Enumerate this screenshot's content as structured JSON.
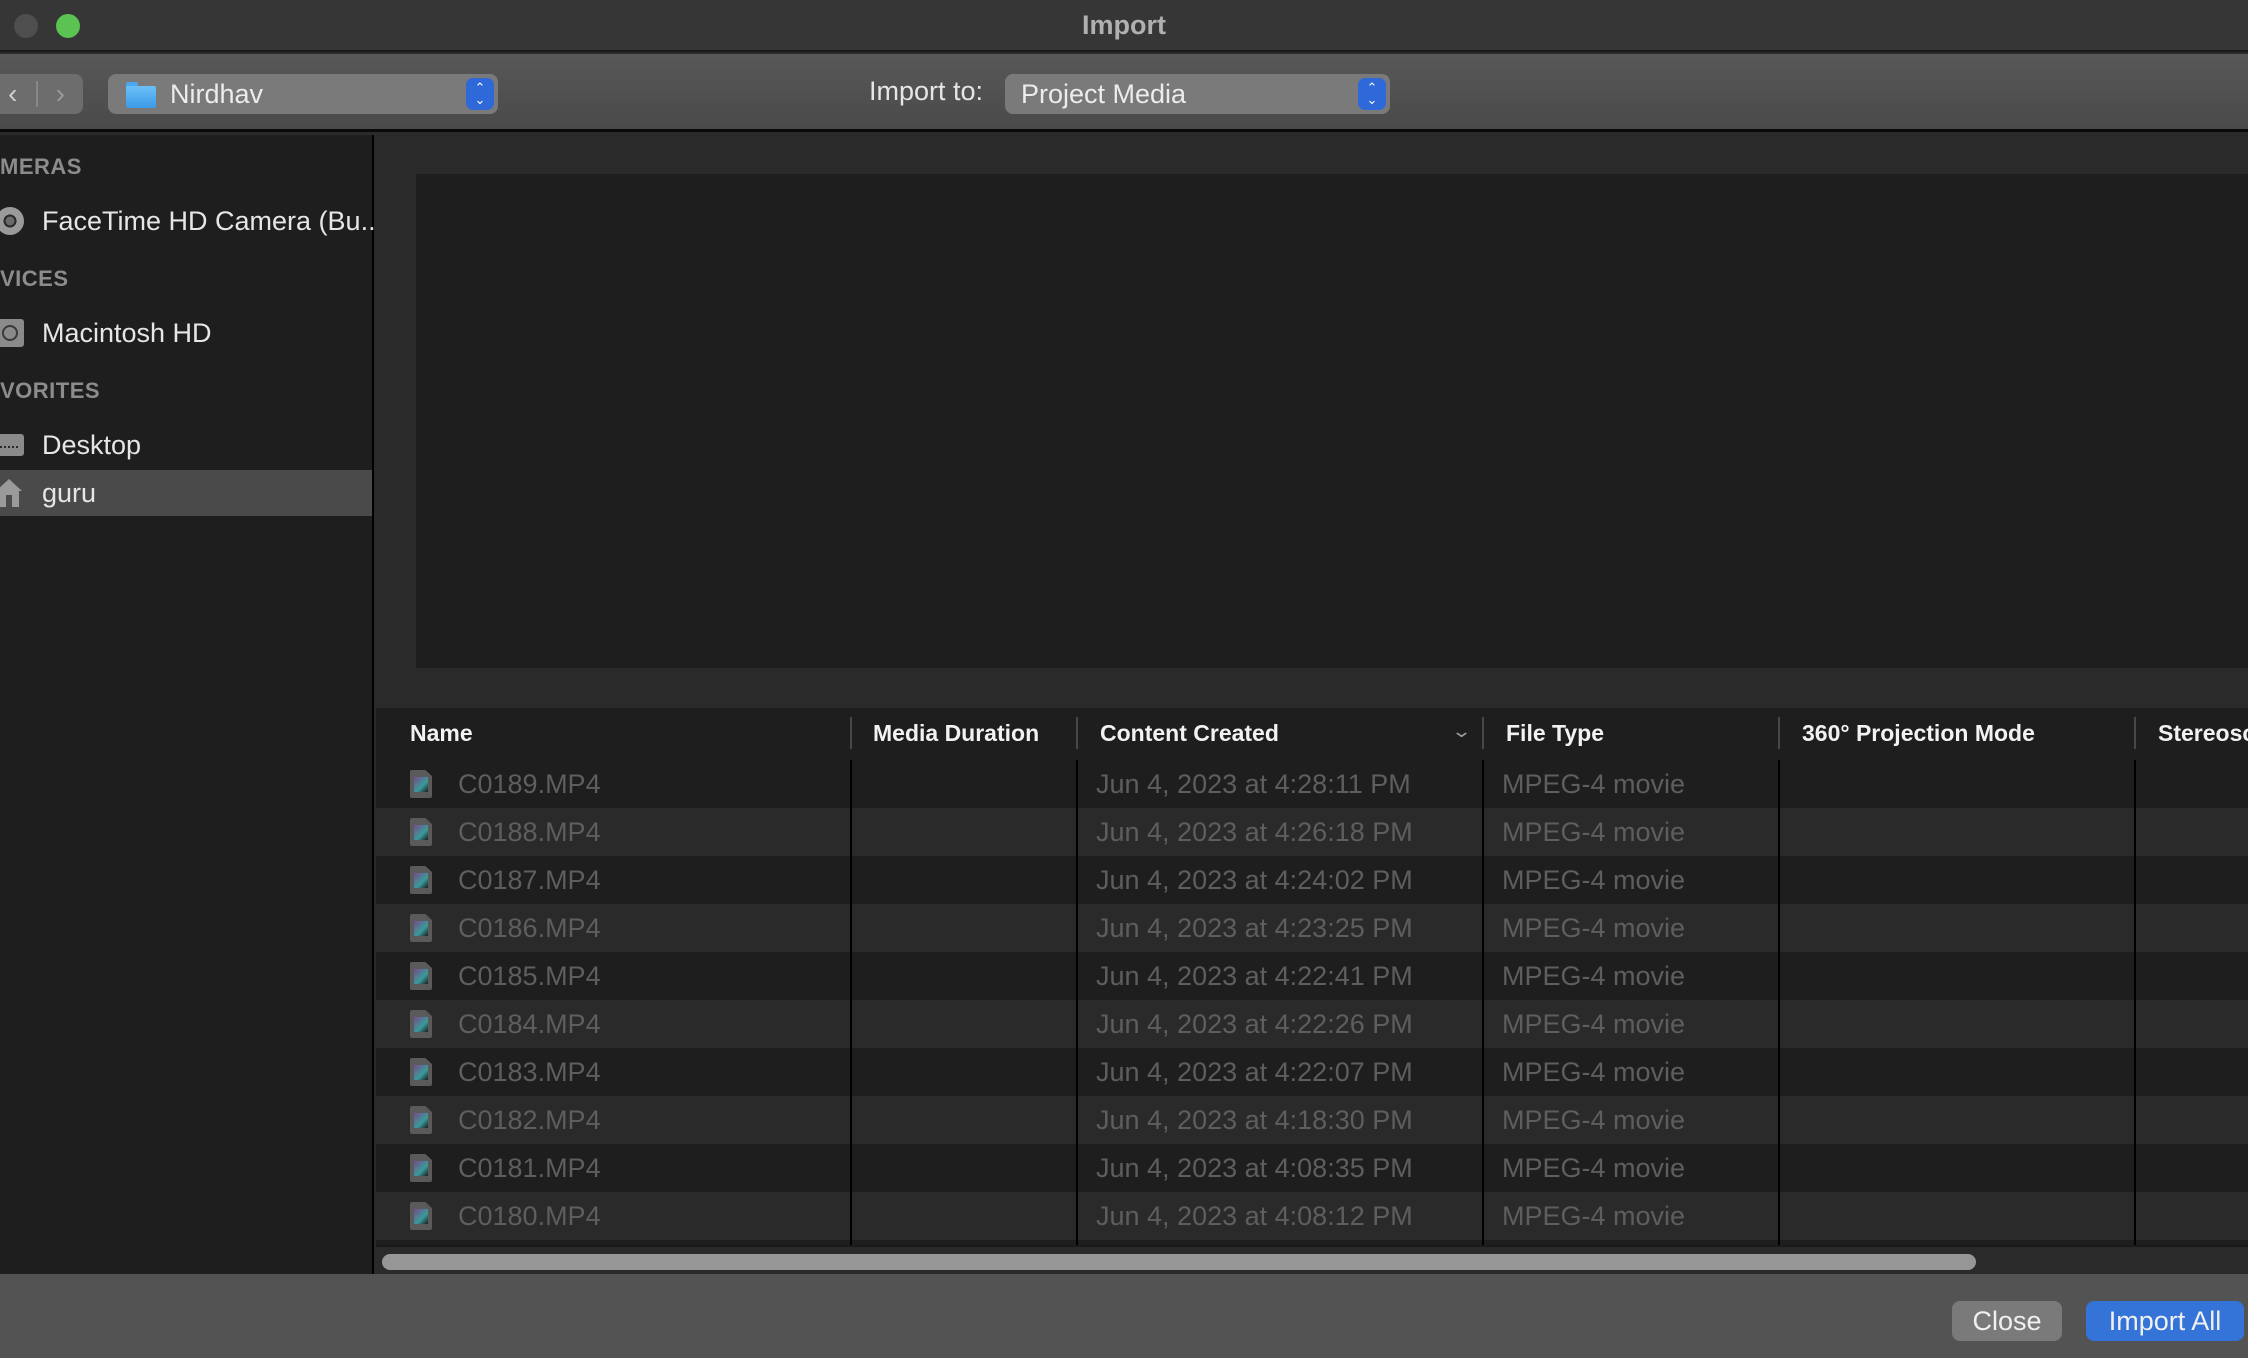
{
  "window": {
    "title": "Import"
  },
  "toolbar": {
    "back_icon": "chevron-left",
    "forward_icon": "chevron-right",
    "location": {
      "icon": "folder-icon",
      "value": "Nirdhav"
    },
    "import_to_label": "Import to:",
    "import_to": {
      "value": "Project Media"
    },
    "stepper_up": "⌃",
    "stepper_down": "⌄"
  },
  "sidebar": {
    "sections": [
      {
        "header": "MERAS",
        "items": [
          {
            "label": "FaceTime HD Camera (Bu...",
            "icon": "camera-icon",
            "selected": false
          }
        ]
      },
      {
        "header": "VICES",
        "items": [
          {
            "label": "Macintosh HD",
            "icon": "hard-drive-icon",
            "selected": false
          }
        ]
      },
      {
        "header": "VORITES",
        "items": [
          {
            "label": "Desktop",
            "icon": "desktop-icon",
            "selected": false
          },
          {
            "label": "guru",
            "icon": "home-icon",
            "selected": true
          }
        ]
      }
    ]
  },
  "table": {
    "columns": [
      {
        "label": "Name"
      },
      {
        "label": "Media Duration"
      },
      {
        "label": "Content Created",
        "sorted": "descending"
      },
      {
        "label": "File Type"
      },
      {
        "label": "360° Projection Mode"
      },
      {
        "label": "Stereosc"
      }
    ],
    "sort_icon": "⌄",
    "rows": [
      {
        "name": "C0189.MP4",
        "duration": "",
        "created": "Jun 4, 2023 at 4:28:11 PM",
        "type": "MPEG-4 movie",
        "projection": "",
        "stereo": ""
      },
      {
        "name": "C0188.MP4",
        "duration": "",
        "created": "Jun 4, 2023 at 4:26:18 PM",
        "type": "MPEG-4 movie",
        "projection": "",
        "stereo": ""
      },
      {
        "name": "C0187.MP4",
        "duration": "",
        "created": "Jun 4, 2023 at 4:24:02 PM",
        "type": "MPEG-4 movie",
        "projection": "",
        "stereo": ""
      },
      {
        "name": "C0186.MP4",
        "duration": "",
        "created": "Jun 4, 2023 at 4:23:25 PM",
        "type": "MPEG-4 movie",
        "projection": "",
        "stereo": ""
      },
      {
        "name": "C0185.MP4",
        "duration": "",
        "created": "Jun 4, 2023 at 4:22:41 PM",
        "type": "MPEG-4 movie",
        "projection": "",
        "stereo": ""
      },
      {
        "name": "C0184.MP4",
        "duration": "",
        "created": "Jun 4, 2023 at 4:22:26 PM",
        "type": "MPEG-4 movie",
        "projection": "",
        "stereo": ""
      },
      {
        "name": "C0183.MP4",
        "duration": "",
        "created": "Jun 4, 2023 at 4:22:07 PM",
        "type": "MPEG-4 movie",
        "projection": "",
        "stereo": ""
      },
      {
        "name": "C0182.MP4",
        "duration": "",
        "created": "Jun 4, 2023 at 4:18:30 PM",
        "type": "MPEG-4 movie",
        "projection": "",
        "stereo": ""
      },
      {
        "name": "C0181.MP4",
        "duration": "",
        "created": "Jun 4, 2023 at 4:08:35 PM",
        "type": "MPEG-4 movie",
        "projection": "",
        "stereo": ""
      },
      {
        "name": "C0180.MP4",
        "duration": "",
        "created": "Jun 4, 2023 at 4:08:12 PM",
        "type": "MPEG-4 movie",
        "projection": "",
        "stereo": ""
      }
    ]
  },
  "footer": {
    "close_label": "Close",
    "import_all_label": "Import All"
  },
  "colors": {
    "accent": "#3473d8",
    "stepper": "#2f68d8",
    "traffic_green": "#5ac351",
    "selected_row": "#4a4a4a"
  }
}
